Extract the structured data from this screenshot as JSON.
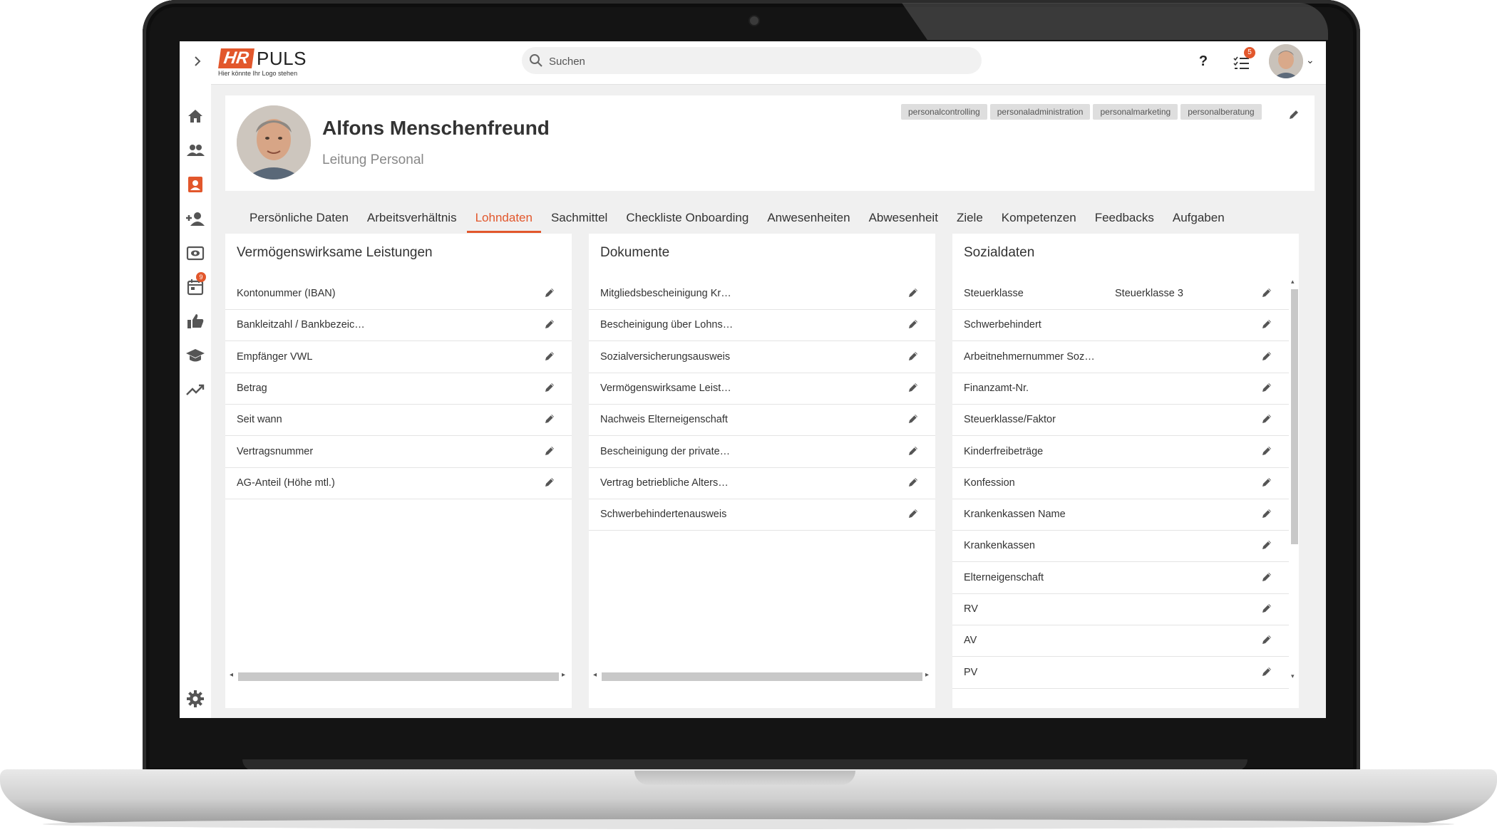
{
  "app": {
    "logo_brand": "HR",
    "logo_product": "PULS",
    "logo_tagline": "Hier könnte Ihr Logo stehen"
  },
  "search": {
    "placeholder": "Suchen"
  },
  "topbar": {
    "help_label": "?",
    "tasks_badge": "5"
  },
  "sidebar": {
    "calendar_badge": "9"
  },
  "profile": {
    "name": "Alfons Menschenfreund",
    "role": "Leitung Personal",
    "tags": [
      "personalcontrolling",
      "personaladministration",
      "personalmarketing",
      "personalberatung"
    ]
  },
  "tabs": [
    {
      "label": "Persönliche Daten"
    },
    {
      "label": "Arbeitsverhältnis"
    },
    {
      "label": "Lohndaten"
    },
    {
      "label": "Sachmittel"
    },
    {
      "label": "Checkliste Onboarding"
    },
    {
      "label": "Anwesenheiten"
    },
    {
      "label": "Abwesenheit"
    },
    {
      "label": "Ziele"
    },
    {
      "label": "Kompetenzen"
    },
    {
      "label": "Feedbacks"
    },
    {
      "label": "Aufgaben"
    }
  ],
  "active_tab": "Lohndaten",
  "panels": {
    "vwl": {
      "title": "Vermögenswirksame Leistungen",
      "rows": [
        {
          "label": "Kontonummer (IBAN)"
        },
        {
          "label": "Bankleitzahl / Bankbezeic…"
        },
        {
          "label": "Empfänger VWL"
        },
        {
          "label": "Betrag"
        },
        {
          "label": "Seit wann"
        },
        {
          "label": "Vertragsnummer"
        },
        {
          "label": "AG-Anteil (Höhe mtl.)"
        }
      ]
    },
    "dokumente": {
      "title": "Dokumente",
      "rows": [
        {
          "label": "Mitgliedsbescheinigung Kr…"
        },
        {
          "label": "Bescheinigung über Lohns…"
        },
        {
          "label": "Sozialversicherungsausweis"
        },
        {
          "label": "Vermögenswirksame Leist…"
        },
        {
          "label": "Nachweis Elterneigenschaft"
        },
        {
          "label": "Bescheinigung der private…"
        },
        {
          "label": "Vertrag betriebliche Alters…"
        },
        {
          "label": "Schwerbehindertenausweis"
        }
      ]
    },
    "sozial": {
      "title": "Sozialdaten",
      "rows": [
        {
          "label": "Steuerklasse",
          "value": "Steuerklasse 3"
        },
        {
          "label": "Schwerbehindert",
          "value": ""
        },
        {
          "label": "Arbeitnehmernummer Soz…",
          "value": ""
        },
        {
          "label": "Finanzamt-Nr.",
          "value": ""
        },
        {
          "label": "Steuerklasse/Faktor",
          "value": ""
        },
        {
          "label": "Kinderfreibeträge",
          "value": ""
        },
        {
          "label": "Konfession",
          "value": ""
        },
        {
          "label": "Krankenkassen Name",
          "value": ""
        },
        {
          "label": "Krankenkassen",
          "value": ""
        },
        {
          "label": "Elterneigenschaft",
          "value": ""
        },
        {
          "label": "RV",
          "value": ""
        },
        {
          "label": "AV",
          "value": ""
        },
        {
          "label": "PV",
          "value": ""
        }
      ]
    }
  },
  "colors": {
    "accent": "#e2572c",
    "sidebar_icon": "#555555",
    "panel_bg": "#ffffff",
    "screen_bg": "#f0f0f0",
    "tag_bg": "#dedede"
  },
  "icons": {
    "sidebar": [
      "home-icon",
      "team-icon",
      "profile-card-icon",
      "add-person-icon",
      "review-icon",
      "calendar-icon",
      "thumbs-up-icon",
      "graduation-cap-icon",
      "trend-icon",
      "settings-gear-icon"
    ],
    "row_action": "pencil-icon"
  }
}
